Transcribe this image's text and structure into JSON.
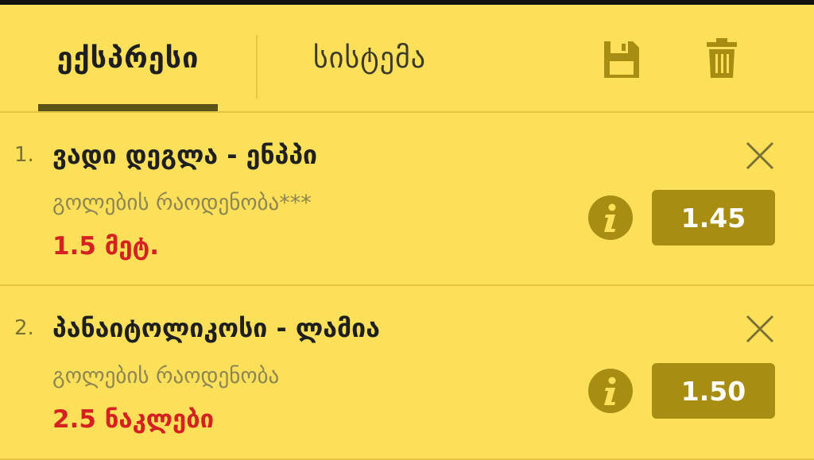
{
  "tabs": [
    {
      "label": "ექსპრესი",
      "active": true
    },
    {
      "label": "სისტემა",
      "active": false
    }
  ],
  "toolbar": {
    "save_icon": "floppy-disk-icon",
    "delete_icon": "trash-icon"
  },
  "bets": [
    {
      "number": "1.",
      "title": "ვადი დეგლა - ენპპი",
      "market": "გოლების რაოდენობა***",
      "pick": "1.5 მეტ.",
      "odds": "1.45"
    },
    {
      "number": "2.",
      "title": "პანაიტოლიკოსი - ლამია",
      "market": "გოლების რაოდენობა",
      "pick": "2.5 ნაკლები",
      "odds": "1.50"
    }
  ],
  "colors": {
    "background": "#fce05a",
    "accent_dark": "#5b5418",
    "odds_button": "#a78e12",
    "pick_text": "#d52121",
    "icon": "#a78e12"
  }
}
